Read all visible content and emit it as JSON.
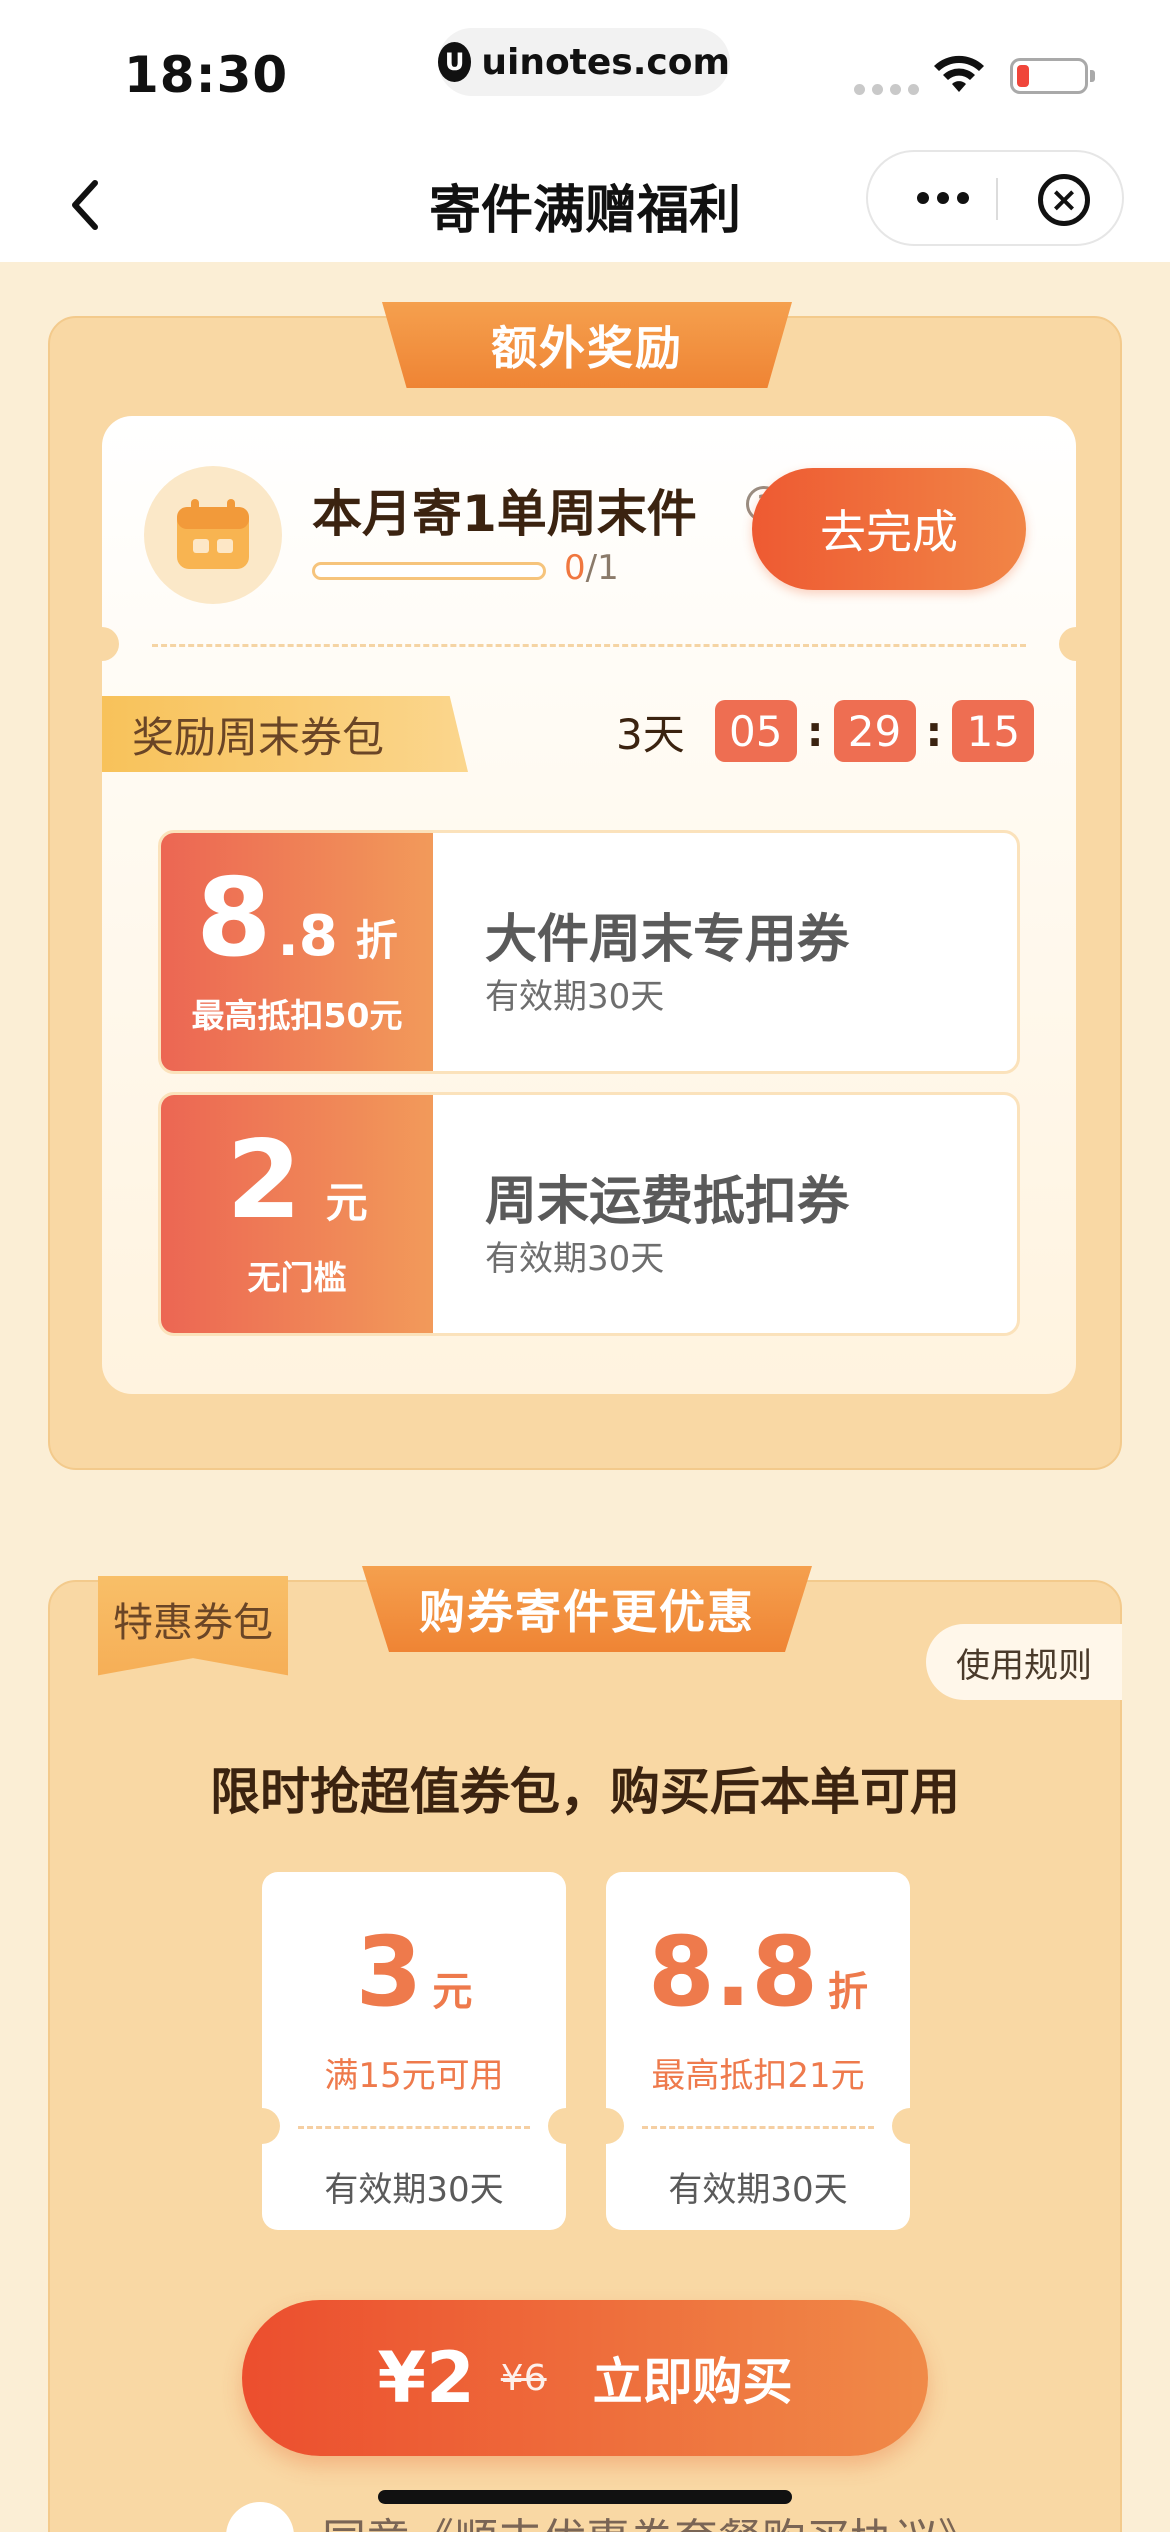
{
  "status_bar": {
    "time": "18:30",
    "url": "uinotes.com",
    "url_logo": "U"
  },
  "nav": {
    "title": "寄件满赠福利",
    "close_glyph": "×"
  },
  "reward_section": {
    "ribbon_title": "额外奖励",
    "task_title": "本月寄1单周末件",
    "help_glyph": "?",
    "progress_current": "0",
    "progress_total": "/1",
    "progress_ratio": 0,
    "complete_button": "去完成",
    "pack_tag": "奖励周末券包",
    "countdown": {
      "days": "3天",
      "hours": "05",
      "minutes": "29",
      "seconds": "15",
      "separator": ":"
    },
    "coupons": [
      {
        "value_int": "8",
        "value_dec": ".8",
        "unit": "折",
        "condition": "最高抵扣50元",
        "name": "大件周末专用券",
        "validity": "有效期30天"
      },
      {
        "value_int": "2",
        "value_dec": "",
        "unit": "元",
        "condition": "无门槛",
        "name": "周末运费抵扣券",
        "validity": "有效期30天"
      }
    ]
  },
  "special_section": {
    "badge": "特惠券包",
    "ribbon_title": "购券寄件更优惠",
    "rules_button": "使用规则",
    "headline": "限时抢超值券包，购买后本单可用",
    "coupons": [
      {
        "value": "3",
        "unit": "元",
        "condition": "满15元可用",
        "validity": "有效期30天"
      },
      {
        "value": "8.8",
        "unit": "折",
        "condition": "最高抵扣21元",
        "validity": "有效期30天"
      }
    ],
    "buy_button": {
      "price": "¥2",
      "original_price": "¥6",
      "label": "立即购买"
    },
    "agreement_text": "同意《顺丰优惠券套餐购买协议》"
  },
  "colors": {
    "accent_orange": "#ee5a32",
    "page_bg": "#fbeed5",
    "section_bg": "#f9d8a4"
  },
  "icons": [
    "back-icon",
    "more-icon",
    "close-icon",
    "calendar-icon",
    "help-icon",
    "wifi-icon",
    "battery-icon",
    "signal-icon",
    "site-logo-icon"
  ]
}
